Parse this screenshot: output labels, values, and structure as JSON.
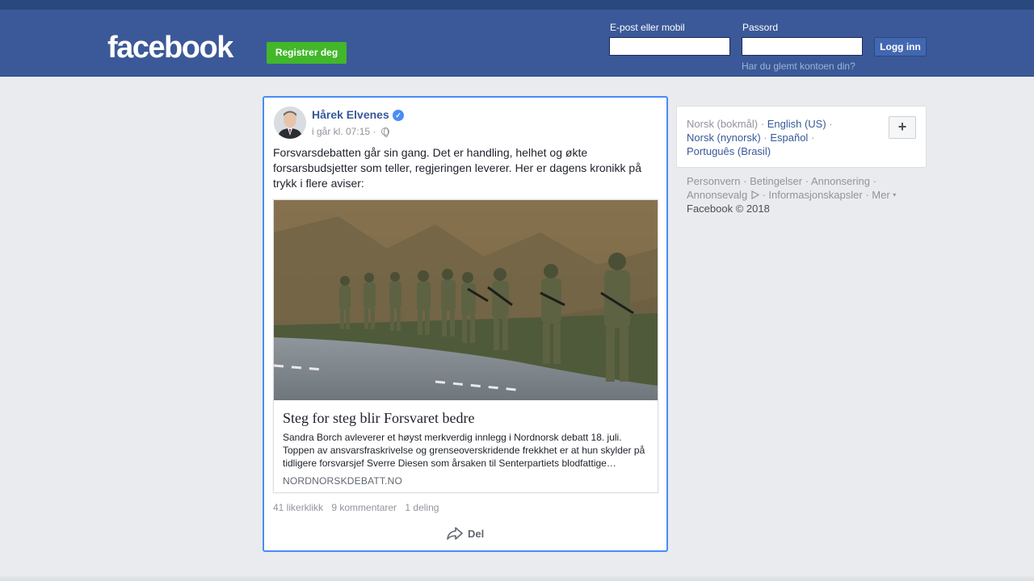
{
  "header": {
    "logo": "facebook",
    "register_label": "Registrer deg",
    "email_label": "E-post eller mobil",
    "password_label": "Passord",
    "email_value": "",
    "password_value": "",
    "login_label": "Logg inn",
    "forgot_label": "Har du glemt kontoen din?"
  },
  "post": {
    "author": "Hårek Elvenes",
    "timestamp": "i går kl. 07:15",
    "sep": "·",
    "text": "Forsvarsdebatten går sin gang. Det er handling, helhet og økte forsarsbudsjetter som teller, regjeringen leverer. Her er dagens kronikk på trykk i flere aviser:",
    "link": {
      "title": "Steg for steg blir Forsvaret bedre",
      "description": "Sandra Borch avleverer et høyst merkverdig innlegg i Nordnorsk debatt 18. juli. Toppen av ansvarsfraskrivelse og grenseoverskridende frekkhet er at hun skylder på tidligere forsvarsjef Sverre Diesen som årsaken til Senterpartiets blodfattige…",
      "domain": "NORDNORSKDEBATT.NO"
    },
    "likes": "41 likerklikk",
    "comments": "9 kommentarer",
    "shares": "1 deling",
    "share_label": "Del"
  },
  "languages": {
    "current": "Norsk (bokmål)",
    "items": [
      "English (US)",
      "Norsk (nynorsk)",
      "Español",
      "Português (Brasil)"
    ],
    "more_label": "+"
  },
  "footer": {
    "links": [
      "Personvern",
      "Betingelser",
      "Annonsering",
      "Annonsevalg",
      "Informasjonskapsler",
      "Mer"
    ],
    "copyright": "Facebook © 2018"
  },
  "colors": {
    "brand": "#3b5998",
    "register_green": "#42b72a",
    "link_blue": "#365899",
    "focus_border": "#4a8cf7"
  }
}
